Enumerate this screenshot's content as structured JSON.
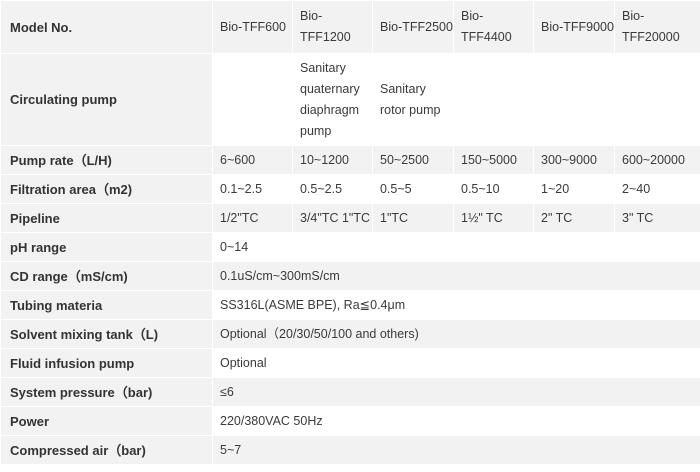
{
  "table": {
    "header": {
      "label": "Model No.",
      "models": [
        "Bio-TFF600",
        "Bio-TFF1200",
        "Bio-TFF2500",
        "Bio-TFF4400",
        "Bio-TFF9000",
        "Bio-TFF20000"
      ]
    },
    "circulating_pump": {
      "label": "Circulating pump",
      "values": [
        "",
        "Sanitary quaternary diaphragm pump",
        "Sanitary rotor pump",
        "",
        "",
        ""
      ]
    },
    "pump_rate": {
      "label": "Pump rate（L/H)",
      "values": [
        "6~600",
        "10~1200",
        "50~2500",
        "150~5000",
        "300~9000",
        "600~20000"
      ]
    },
    "filtration_area": {
      "label": "Filtration area（m2)",
      "values": [
        "0.1~2.5",
        "0.5~2.5",
        "0.5~5",
        "0.5~10",
        "1~20",
        "2~40"
      ]
    },
    "pipeline": {
      "label": "Pipeline",
      "values": [
        "1/2\"TC",
        "3/4\"TC 1\"TC",
        "1\"TC",
        "1½\" TC",
        "2\" TC",
        "3\" TC"
      ]
    },
    "ph_range": {
      "label": "pH range",
      "value": "0~14"
    },
    "cd_range": {
      "label": "CD range（mS/cm)",
      "value": "0.1uS/cm~300mS/cm"
    },
    "tubing_material": {
      "label": "Tubing materia",
      "value": "SS316L(ASME BPE), Ra≦0.4μm"
    },
    "solvent_tank": {
      "label": "Solvent mixing tank（L)",
      "value": "Optional（20/30/50/100 and others)"
    },
    "fluid_infusion": {
      "label": "Fluid infusion pump",
      "value": "Optional"
    },
    "system_pressure": {
      "label": "System pressure（bar)",
      "value": "≤6"
    },
    "power": {
      "label": "Power",
      "value": "220/380VAC 50Hz"
    },
    "compressed_air": {
      "label": "Compressed air（bar)",
      "value": "5~7"
    }
  }
}
